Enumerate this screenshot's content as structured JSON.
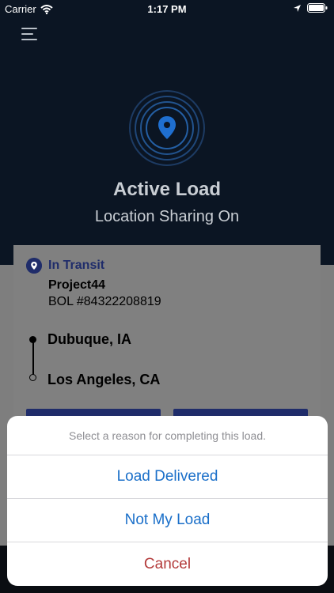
{
  "status_bar": {
    "carrier": "Carrier",
    "time": "1:17 PM",
    "wifi_icon": "wifi-icon",
    "location_icon": "location-arrow-icon",
    "battery_icon": "battery-icon"
  },
  "header": {
    "menu_icon": "hamburger-menu-icon",
    "title": "Active Load",
    "subtitle": "Location Sharing On",
    "pulse_icon": "location-pin-pulse-icon"
  },
  "load_card": {
    "status": "In Transit",
    "company": "Project44",
    "bol": "BOL #84322208819",
    "origin": "Dubuque, IA",
    "destination": "Los Angeles, CA"
  },
  "action_sheet": {
    "title": "Select a reason for completing this load.",
    "options": [
      {
        "label": "Load Delivered"
      },
      {
        "label": "Not My Load"
      }
    ],
    "cancel_label": "Cancel"
  },
  "colors": {
    "hero_background": "#0b1523",
    "accent_blue": "#1a6fc9",
    "brand_navy": "#1f2c6a",
    "cancel_red": "#b33a3a",
    "pin_blue": "#1f6fd0"
  }
}
